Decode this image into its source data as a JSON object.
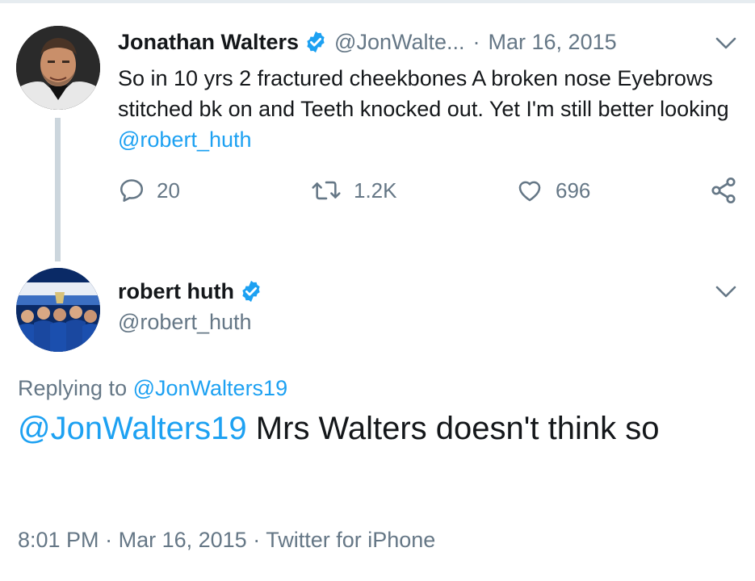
{
  "tweet1": {
    "name": "Jonathan Walters",
    "handle": "@JonWalte...",
    "separator": "·",
    "date": "Mar 16, 2015",
    "text": "So in 10 yrs 2 fractured cheekbones A broken nose Eyebrows stitched bk on and Teeth knocked out. Yet I'm still better looking",
    "mention": "@robert_huth",
    "replies": "20",
    "retweets": "1.2K",
    "likes": "696"
  },
  "tweet2": {
    "name": "robert huth",
    "handle": "@robert_huth",
    "replying_prefix": "Replying to",
    "replying_to": "@JonWalters19",
    "mention": "@JonWalters19",
    "text": "Mrs Walters doesn't think so",
    "time": "8:01 PM",
    "separator": "·",
    "date": "Mar 16, 2015",
    "source": "Twitter for iPhone"
  },
  "colors": {
    "link": "#1da1f2",
    "secondary_text": "#657786",
    "primary_text": "#14171a",
    "verified": "#1da1f2"
  },
  "icons": [
    "verified-badge-icon",
    "chevron-down-icon",
    "reply-icon",
    "retweet-icon",
    "like-icon",
    "share-icon"
  ]
}
